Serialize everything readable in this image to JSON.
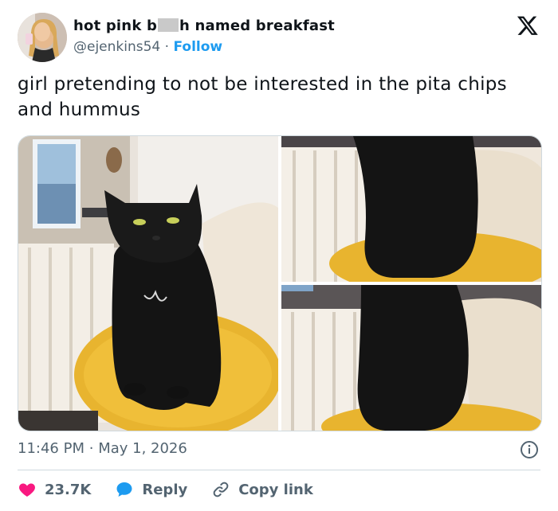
{
  "header": {
    "name_part1": "hot pink b",
    "name_part2": "h named breakfast",
    "handle": "@ejenkins54",
    "separator": "·",
    "follow_label": "Follow"
  },
  "tweet": {
    "text": "girl pretending to not be interested in the pita chips and hummus",
    "time": "11:46 PM",
    "date_separator": "·",
    "date": "May 1, 2026"
  },
  "actions": {
    "like_count": "23.7K",
    "reply_label": "Reply",
    "copy_label": "Copy link"
  },
  "icons": {
    "logo": "x-logo-icon",
    "info": "info-icon",
    "like": "heart-icon",
    "reply": "speech-bubble-icon",
    "copy": "link-icon"
  },
  "colors": {
    "accent": "#1d9bf0",
    "like": "#f91880",
    "text": "#0f1419",
    "muted": "#536471"
  }
}
